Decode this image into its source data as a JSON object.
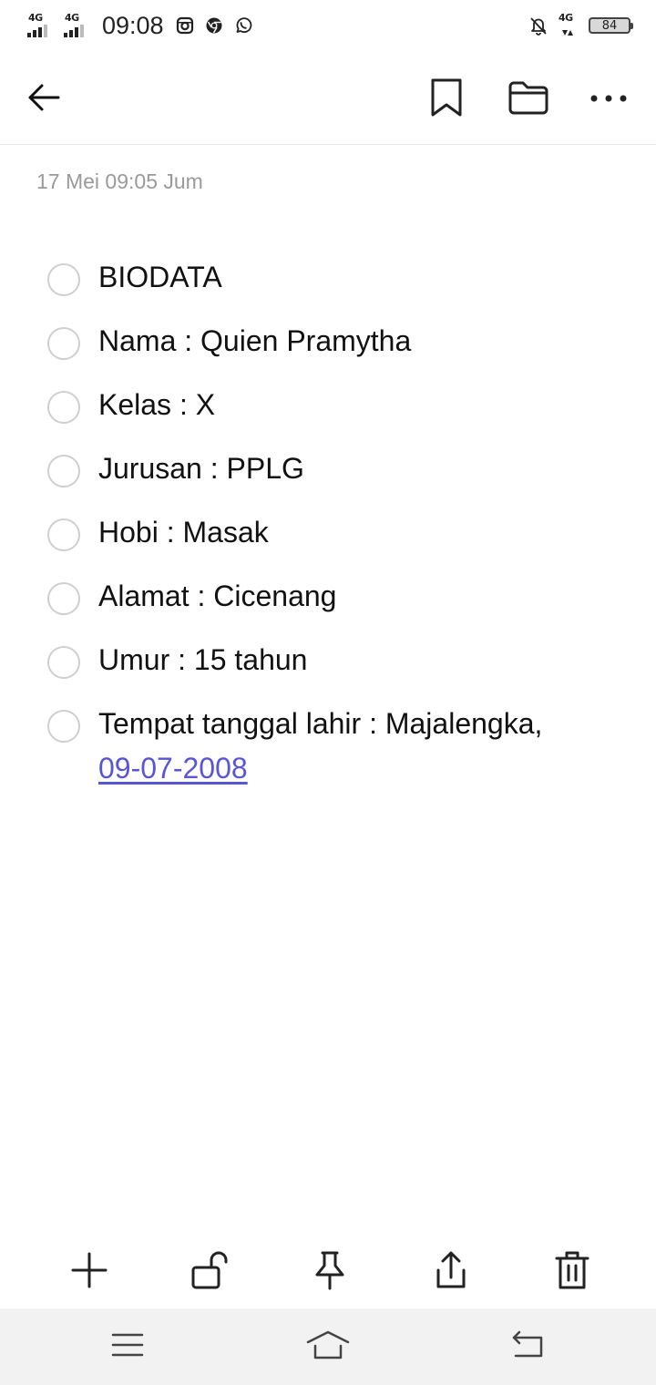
{
  "status_bar": {
    "sim1_network": "4G",
    "sim2_network": "4G",
    "time": "09:08",
    "right_network": "4G",
    "battery_level": "84",
    "icons": [
      "instagram-icon",
      "chrome-icon",
      "whatsapp-icon",
      "notifications-off-icon"
    ]
  },
  "header": {
    "icons": [
      "back-arrow-icon",
      "bookmark-icon",
      "folder-icon",
      "more-horizontal-icon"
    ]
  },
  "note": {
    "date": "17 Mei 09:05 Jum",
    "items": [
      {
        "text": "BIODATA",
        "checked": false
      },
      {
        "text": "Nama : Quien Pramytha",
        "checked": false
      },
      {
        "text": "Kelas : X",
        "checked": false
      },
      {
        "text": "Jurusan : PPLG",
        "checked": false
      },
      {
        "text": "Hobi : Masak",
        "checked": false
      },
      {
        "text": "Alamat : Cicenang",
        "checked": false
      },
      {
        "text": "Umur : 15 tahun",
        "checked": false
      },
      {
        "text": "Tempat tanggal lahir : Majalengka,",
        "link": "09-07-2008",
        "checked": false
      }
    ],
    "link_color": "#5a55d6"
  },
  "toolbar": {
    "icons": [
      "plus-icon",
      "unlock-icon",
      "pin-icon",
      "share-icon",
      "trash-icon"
    ]
  },
  "nav_bar": {
    "icons": [
      "menu-icon",
      "home-icon",
      "back-icon"
    ]
  }
}
